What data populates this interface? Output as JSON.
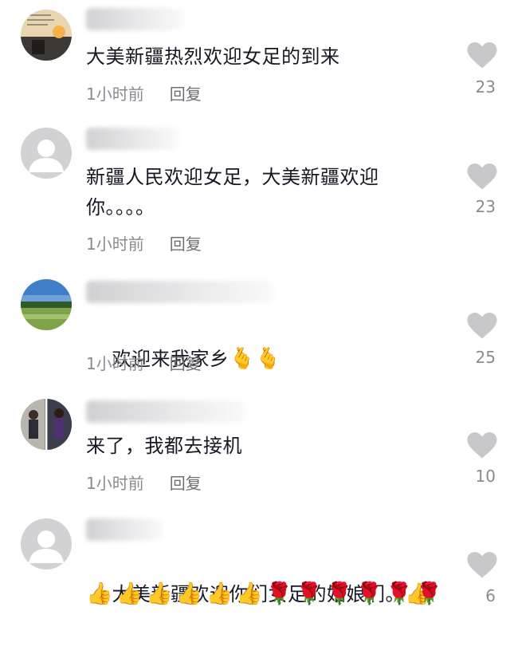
{
  "like_icon": "heart-icon",
  "colors": {
    "text": "#161823",
    "meta": "#8a8b91",
    "like_icon": "#c8c8cb"
  },
  "comments": [
    {
      "text": "大美新疆热烈欢迎女足的到来",
      "time": "1小时前",
      "reply": "回复",
      "likes": "23"
    },
    {
      "text": "新疆人民欢迎女足，大美新疆欢迎你。。。。",
      "time": "1小时前",
      "reply": "回复",
      "likes": "23"
    },
    {
      "text": "欢迎来我家乡",
      "emoji": "🫰🫰",
      "time": "1小时前",
      "reply": "回复",
      "likes": "25"
    },
    {
      "text": "来了，我都去接机",
      "time": "1小时前",
      "reply": "回复",
      "likes": "10"
    },
    {
      "text": "大美新疆欢迎你们女足的姑娘们。",
      "emoji": "👍",
      "emoji_row": "👍👍👍👍👍👍🌹🌹🌹🌹🌹🌹",
      "likes": "6"
    }
  ]
}
